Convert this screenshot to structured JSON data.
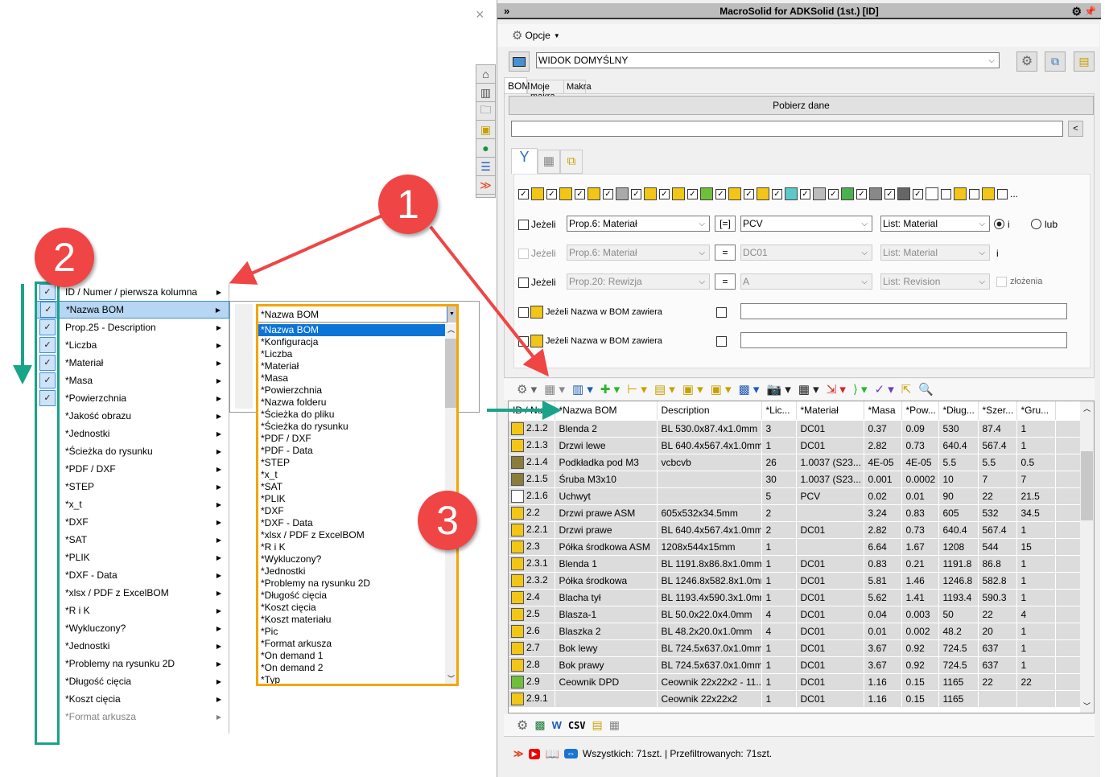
{
  "left_menu": {
    "items": [
      {
        "label": "ID / Numer / pierwsza kolumna",
        "checked": true
      },
      {
        "label": "*Nazwa BOM",
        "checked": true,
        "selected": true
      },
      {
        "label": "Prop.25 - Description",
        "checked": true
      },
      {
        "label": "*Liczba",
        "checked": true
      },
      {
        "label": "*Materiał",
        "checked": true
      },
      {
        "label": "*Masa",
        "checked": true
      },
      {
        "label": "*Powierzchnia",
        "checked": true
      },
      {
        "label": "*Jakość obrazu",
        "checked": false
      },
      {
        "label": "*Jednostki",
        "checked": false
      },
      {
        "label": "*Ścieżka do rysunku",
        "checked": false
      },
      {
        "label": "*PDF / DXF",
        "checked": false
      },
      {
        "label": "*STEP",
        "checked": false
      },
      {
        "label": "*x_t",
        "checked": false
      },
      {
        "label": "*DXF",
        "checked": false
      },
      {
        "label": "*SAT",
        "checked": false
      },
      {
        "label": "*PLIK",
        "checked": false
      },
      {
        "label": "*DXF - Data",
        "checked": false
      },
      {
        "label": "*xlsx / PDF z ExcelBOM",
        "checked": false
      },
      {
        "label": "*R i K",
        "checked": false
      },
      {
        "label": "*Wykluczony?",
        "checked": false
      },
      {
        "label": "*Jednostki",
        "checked": false
      },
      {
        "label": "*Problemy na rysunku 2D",
        "checked": false
      },
      {
        "label": "*Długość cięcia",
        "checked": false
      },
      {
        "label": "*Koszt cięcia",
        "checked": false
      },
      {
        "label": "*Format arkusza",
        "checked": false
      }
    ]
  },
  "dropdown": {
    "value": "*Nazwa BOM",
    "options": [
      "*Nazwa BOM",
      "*Konfiguracja",
      "*Liczba",
      "*Materiał",
      "*Masa",
      "*Powierzchnia",
      "*Nazwa folderu",
      "*Ścieżka do pliku",
      "*Ścieżka do rysunku",
      "*PDF / DXF",
      "*PDF - Data",
      "*STEP",
      "*x_t",
      "*SAT",
      "*PLIK",
      "*DXF",
      "*DXF - Data",
      "*xlsx / PDF z ExcelBOM",
      "*R i K",
      "*Wykluczony?",
      "*Jednostki",
      "*Problemy na rysunku 2D",
      "*Długość cięcia",
      "*Koszt cięcia",
      "*Koszt materiału",
      "*Pic",
      "*Format arkusza",
      "*On demand 1",
      "*On demand 2",
      "*Typ"
    ]
  },
  "badges": {
    "b1": "1",
    "b2": "2",
    "b3": "3"
  },
  "colors": {
    "annotation_red": "#f04545",
    "annotation_green": "#19a389",
    "highlight_orange": "#f5a400",
    "selection_blue": "#0b74d6"
  },
  "window": {
    "title": "MacroSolid for ADKSolid (1st.) [ID]",
    "close": "×",
    "options_label": "Opcje",
    "view_value": "WIDOK DOMYŚLNY",
    "tabs": [
      "BOM",
      "Moje makra",
      "Makra"
    ],
    "fetch_button": "Pobierz dane",
    "back_button": "<",
    "sidebar_icons": [
      "home-icon",
      "parts-icon",
      "folder-icon",
      "drawing-icon",
      "color-wheel-icon",
      "list-icon",
      "expand-icon"
    ]
  },
  "filters": {
    "type_toggles": [
      true,
      true,
      true,
      true,
      true,
      true,
      true,
      true,
      true,
      true,
      true,
      true,
      true,
      true,
      true,
      false,
      false
    ],
    "rows": [
      {
        "label": "Jeżeli",
        "enabled": true,
        "prop": "Prop.6: Materiał",
        "op": "[=]",
        "value": "PCV",
        "list": "List: Material",
        "tail": "i",
        "tail2": "lub"
      },
      {
        "label": "Jeżeli",
        "enabled": false,
        "prop": "Prop.6: Materiał",
        "op": "=",
        "value": "DC01",
        "list": "List: Material",
        "tail": "i"
      },
      {
        "label": "Jeżeli",
        "enabled": false,
        "prop": "Prop.20: Rewizja",
        "op": "=",
        "value": "A",
        "list": "List: Revision",
        "tail": "złożenia"
      }
    ],
    "name_rows": [
      "Jeżeli Nazwa w BOM zawiera",
      "Jeżeli Nazwa w BOM zawiera"
    ],
    "more": "..."
  },
  "table": {
    "columns": [
      "ID / Nu...",
      "*Nazwa BOM",
      "Description",
      "*Lic...",
      "*Materiał",
      "*Masa",
      "*Pow...",
      "*Dług...",
      "*Szer...",
      "*Gru..."
    ],
    "rows": [
      [
        "2.1.2",
        "Blenda 2",
        "BL 530.0x87.4x1.0mm",
        "3",
        "DC01",
        "0.37",
        "0.09",
        "530",
        "87.4",
        "1"
      ],
      [
        "2.1.3",
        "Drzwi lewe",
        "BL 640.4x567.4x1.0mm",
        "1",
        "DC01",
        "2.82",
        "0.73",
        "640.4",
        "567.4",
        "1"
      ],
      [
        "2.1.4",
        "Podkładka pod M3",
        "vcbcvb",
        "26",
        "1.0037 (S23...",
        "4E-05",
        "4E-05",
        "5.5",
        "5.5",
        "0.5"
      ],
      [
        "2.1.5",
        "Śruba M3x10",
        "",
        "30",
        "1.0037 (S23...",
        "0.001",
        "0.0002",
        "10",
        "7",
        "7"
      ],
      [
        "2.1.6",
        "Uchwyt",
        "",
        "5",
        "PCV",
        "0.02",
        "0.01",
        "90",
        "22",
        "21.5"
      ],
      [
        "2.2",
        "Drzwi prawe ASM",
        "605x532x34.5mm",
        "2",
        "",
        "3.24",
        "0.83",
        "605",
        "532",
        "34.5"
      ],
      [
        "2.2.1",
        "Drzwi prawe",
        "BL 640.4x567.4x1.0mm",
        "2",
        "DC01",
        "2.82",
        "0.73",
        "640.4",
        "567.4",
        "1"
      ],
      [
        "2.3",
        "Półka środkowa ASM",
        "1208x544x15mm",
        "1",
        "",
        "6.64",
        "1.67",
        "1208",
        "544",
        "15"
      ],
      [
        "2.3.1",
        "Blenda 1",
        "BL 1191.8x86.8x1.0mm",
        "1",
        "DC01",
        "0.83",
        "0.21",
        "1191.8",
        "86.8",
        "1"
      ],
      [
        "2.3.2",
        "Półka środkowa",
        "BL 1246.8x582.8x1.0mm",
        "1",
        "DC01",
        "5.81",
        "1.46",
        "1246.8",
        "582.8",
        "1"
      ],
      [
        "2.4",
        "Blacha tył",
        "BL 1193.4x590.3x1.0mm",
        "1",
        "DC01",
        "5.62",
        "1.41",
        "1193.4",
        "590.3",
        "1"
      ],
      [
        "2.5",
        "Blasza-1",
        "BL 50.0x22.0x4.0mm",
        "4",
        "DC01",
        "0.04",
        "0.003",
        "50",
        "22",
        "4"
      ],
      [
        "2.6",
        "Blaszka 2",
        "BL 48.2x20.0x1.0mm",
        "4",
        "DC01",
        "0.01",
        "0.002",
        "48.2",
        "20",
        "1"
      ],
      [
        "2.7",
        "Bok lewy",
        "BL 724.5x637.0x1.0mm",
        "1",
        "DC01",
        "3.67",
        "0.92",
        "724.5",
        "637",
        "1"
      ],
      [
        "2.8",
        "Bok prawy",
        "BL 724.5x637.0x1.0mm",
        "1",
        "DC01",
        "3.67",
        "0.92",
        "724.5",
        "637",
        "1"
      ],
      [
        "2.9",
        "Ceownik DPD",
        "Ceownik 22x22x2 - 11...",
        "1",
        "DC01",
        "1.16",
        "0.15",
        "1165",
        "22",
        "22"
      ],
      [
        "2.9.1",
        "",
        "Ceownik 22x22x2",
        "1",
        "DC01",
        "1.16",
        "0.15",
        "1165",
        "",
        ""
      ]
    ],
    "row_icons": [
      "sheet",
      "sheet",
      "screw",
      "screw",
      "cart",
      "asm",
      "sheet",
      "asm",
      "sheet",
      "sheet",
      "sheet",
      "sheet",
      "sheet",
      "sheet",
      "sheet",
      "weld",
      "beam"
    ]
  },
  "bottom_toolbar": {
    "csv_label": "CSV"
  },
  "status": {
    "text": "Wszystkich: 71szt. | Przefiltrowanych: 71szt."
  }
}
